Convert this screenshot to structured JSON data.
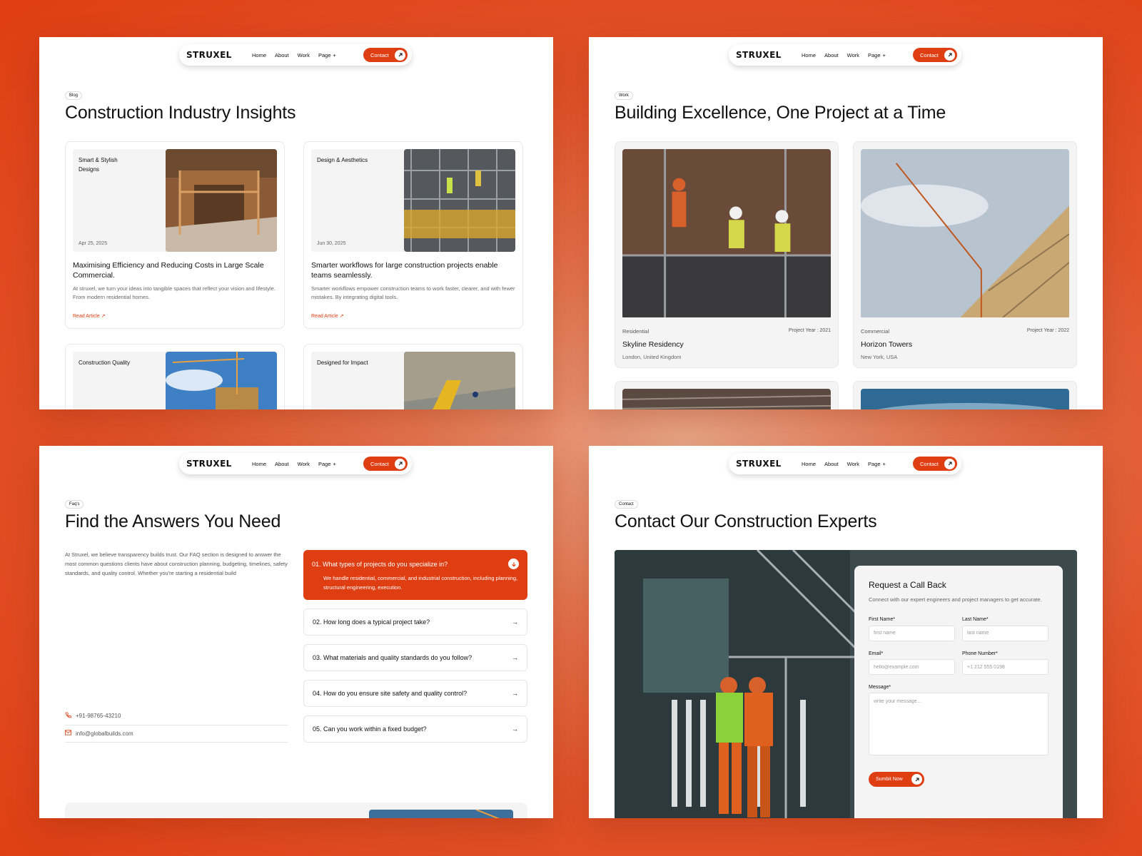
{
  "brand": {
    "logo": "STRUXEL",
    "accent": "#df3d12"
  },
  "nav": {
    "home": "Home",
    "about": "About",
    "work": "Work",
    "page": "Page",
    "page_plus": "+",
    "contact": "Contact"
  },
  "blog": {
    "tag": "Blog",
    "title": "Construction Industry Insights",
    "cards": [
      {
        "category": "Smart & Stylish Designs",
        "date": "Apr 25, 2025",
        "title": "Maximising Efficiency and Reducing Costs in Large Scale Commercial.",
        "excerpt": "At struxel, we turn your ideas into tangible spaces that reflect your vision and lifestyle. From modern residential homes.",
        "cta": "Read Article"
      },
      {
        "category": "Design & Aesthetics",
        "date": "Jun 30, 2025",
        "title": "Smarter workflows for large construction projects enable teams seamlessly.",
        "excerpt": "Smarter workflows empower construction teams to work faster, clearer, and with fewer mistakes. By integrating digital tools.",
        "cta": "Read Article"
      },
      {
        "category": "Construction Quality"
      },
      {
        "category": "Designed for Impact"
      }
    ]
  },
  "work": {
    "tag": "Work",
    "title": "Building Excellence, One Project at a Time",
    "projects": [
      {
        "type": "Residential",
        "year": "Project Year : 2021",
        "name": "Skyline Residency",
        "location": "London, United Kingdom"
      },
      {
        "type": "Commercial",
        "year": "Project Year : 2022",
        "name": "Horizon Towers",
        "location": "New York, USA"
      }
    ]
  },
  "faq": {
    "tag": "Faq's",
    "title": "Find the Answers You Need",
    "intro": "At Struxel, we believe transparency builds trust. Our FAQ section is designed to answer the most common questions clients have about construction planning, budgeting, timelines, safety standards, and quality control. Whether you're starting a residential build",
    "phone": "+91-98765-43210",
    "email": "info@globalbuilds.com",
    "open": {
      "question": "01.  What types of projects do you specialize in?",
      "answer": "We handle residential, commercial, and industrial construction, including planning, structural engineering, execution."
    },
    "items": [
      "02.  How long does a typical project take?",
      "03.  What materials and quality standards do you follow?",
      "04.  How do you ensure site safety and quality control?",
      "05.  Can you work within a fixed budget?"
    ]
  },
  "contact": {
    "tag": "Contact",
    "title": "Contact Our Construction Experts",
    "form_title": "Request a Call Back",
    "form_sub": "Connect with our expert engineers and project managers to get accurate.",
    "first_name": {
      "label": "First Name*",
      "placeholder": "first name"
    },
    "last_name": {
      "label": "Last Name*",
      "placeholder": "last name"
    },
    "email": {
      "label": "Email*",
      "placeholder": "hello@example.com"
    },
    "phone": {
      "label": "Phone Number*",
      "placeholder": "+1 212 555 0198"
    },
    "message": {
      "label": "Message*",
      "placeholder": "write your message..."
    },
    "submit": "Sumbit Now"
  }
}
